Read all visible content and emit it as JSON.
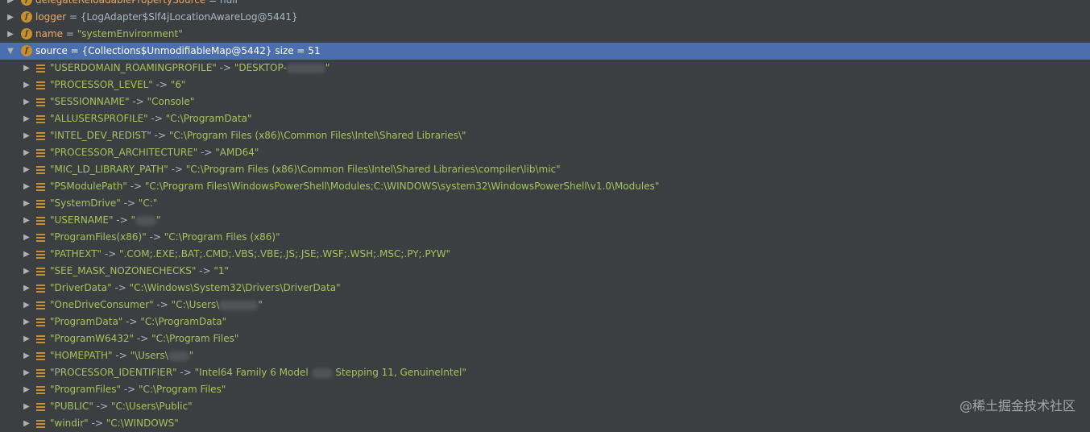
{
  "fields": [
    {
      "name": "delegateReloadablePropertySource",
      "value": "null",
      "expanded": false
    },
    {
      "name": "logger",
      "value": "{LogAdapter$Slf4jLocationAwareLog@5441}",
      "expanded": false
    },
    {
      "name": "name",
      "value": "\"systemEnvironment\"",
      "expanded": false
    },
    {
      "name": "source",
      "value": "{Collections$UnmodifiableMap@5442}  size = 51",
      "expanded": true
    }
  ],
  "entries": [
    {
      "key": "\"USERDOMAIN_ROAMINGPROFILE\"",
      "value": "\"DESKTOP-",
      "tail": "\""
    },
    {
      "key": "\"PROCESSOR_LEVEL\"",
      "value": "\"6\""
    },
    {
      "key": "\"SESSIONNAME\"",
      "value": "\"Console\""
    },
    {
      "key": "\"ALLUSERSPROFILE\"",
      "value": "\"C:\\ProgramData\""
    },
    {
      "key": "\"INTEL_DEV_REDIST\"",
      "value": "\"C:\\Program Files (x86)\\Common Files\\Intel\\Shared Libraries\\\""
    },
    {
      "key": "\"PROCESSOR_ARCHITECTURE\"",
      "value": "\"AMD64\""
    },
    {
      "key": "\"MIC_LD_LIBRARY_PATH\"",
      "value": "\"C:\\Program Files (x86)\\Common Files\\Intel\\Shared Libraries\\compiler\\lib\\mic\""
    },
    {
      "key": "\"PSModulePath\"",
      "value": "\"C:\\Program Files\\WindowsPowerShell\\Modules;C:\\WINDOWS\\system32\\WindowsPowerShell\\v1.0\\Modules\""
    },
    {
      "key": "\"SystemDrive\"",
      "value": "\"C:\""
    },
    {
      "key": "\"USERNAME\"",
      "value": "\"",
      "tail": "\""
    },
    {
      "key": "\"ProgramFiles(x86)\"",
      "value": "\"C:\\Program Files (x86)\""
    },
    {
      "key": "\"PATHEXT\"",
      "value": "\".COM;.EXE;.BAT;.CMD;.VBS;.VBE;.JS;.JSE;.WSF;.WSH;.MSC;.PY;.PYW\""
    },
    {
      "key": "\"SEE_MASK_NOZONECHECKS\"",
      "value": "\"1\""
    },
    {
      "key": "\"DriverData\"",
      "value": "\"C:\\Windows\\System32\\Drivers\\DriverData\""
    },
    {
      "key": "\"OneDriveConsumer\"",
      "value": "\"C:\\Users\\",
      "tail": "\""
    },
    {
      "key": "\"ProgramData\"",
      "value": "\"C:\\ProgramData\""
    },
    {
      "key": "\"ProgramW6432\"",
      "value": "\"C:\\Program Files\""
    },
    {
      "key": "\"HOMEPATH\"",
      "value": "\"\\Users\\",
      "tail": "\""
    },
    {
      "key": "\"PROCESSOR_IDENTIFIER\"",
      "value": "\"Intel64 Family 6 Model ",
      "tail": " Stepping 11, GenuineIntel\""
    },
    {
      "key": "\"ProgramFiles\"",
      "value": "\"C:\\Program Files\""
    },
    {
      "key": "\"PUBLIC\"",
      "value": "\"C:\\Users\\Public\""
    },
    {
      "key": "\"windir\"",
      "value": "\"C:\\WINDOWS\""
    }
  ],
  "arrow_separator": " -> ",
  "equals": " = ",
  "field_icon_letter": "f",
  "watermark": "@稀土掘金技术社区",
  "colors": {
    "background": "#3c3f41",
    "selection": "#4b6eaf",
    "field_icon": "#c88f2e",
    "string": "#a5c25c",
    "field_name": "#eea865"
  }
}
